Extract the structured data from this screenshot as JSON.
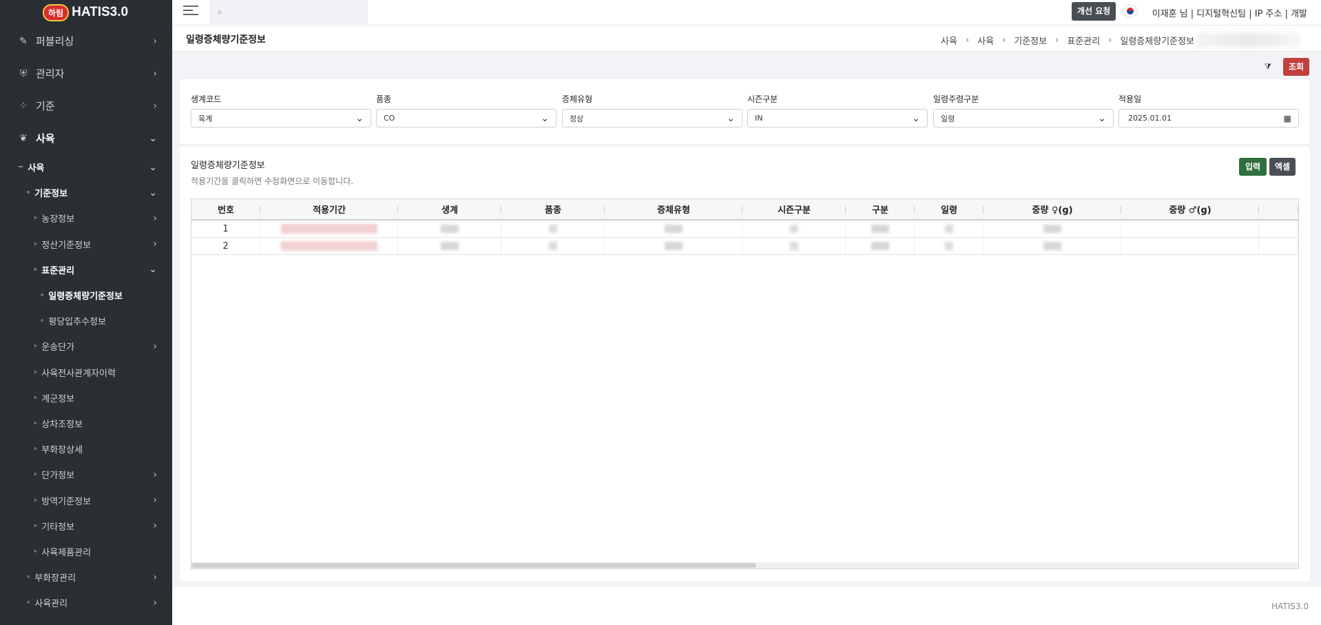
{
  "app": {
    "badge": "하림",
    "name": "HATIS3.0"
  },
  "sidebar": {
    "top": [
      {
        "icon": "rocket-icon",
        "glyph": "🚀",
        "label": "퍼블리싱"
      },
      {
        "icon": "shield-icon",
        "glyph": "⛨",
        "label": "관리자"
      },
      {
        "icon": "grid-icon",
        "glyph": "⁘",
        "label": "기준"
      },
      {
        "icon": "leaf-icon",
        "glyph": "❦",
        "label": "사육"
      }
    ],
    "items": [
      {
        "label": "사육"
      },
      {
        "label": "기준정보"
      },
      {
        "label": "농장정보"
      },
      {
        "label": "정산기준정보"
      },
      {
        "label": "표준관리"
      },
      {
        "label": "일령증체량기준정보"
      },
      {
        "label": "평당입추수정보"
      },
      {
        "label": "운송단가"
      },
      {
        "label": "사육전사관계자이력"
      },
      {
        "label": "계군정보"
      },
      {
        "label": "상차조정보"
      },
      {
        "label": "부화장상세"
      },
      {
        "label": "단가정보"
      },
      {
        "label": "방역기준정보"
      },
      {
        "label": "기타정보"
      },
      {
        "label": "사육제품관리"
      },
      {
        "label": "부화장관리"
      },
      {
        "label": "사육관리"
      }
    ]
  },
  "header": {
    "improve_btn": "개선 요청",
    "user_info": "이재훈 님 | 디지털혁신팀 | IP 주소 | 개발"
  },
  "page": {
    "title": "일령증체량기준정보",
    "breadcrumb": [
      "사육",
      "사육",
      "기준정보",
      "표준관리",
      "일령증체량기준정보"
    ]
  },
  "actions": {
    "search_btn": "조회"
  },
  "filters": [
    {
      "label": "생계코드",
      "value": "육계",
      "type": "select"
    },
    {
      "label": "품종",
      "value": "CO",
      "type": "select"
    },
    {
      "label": "증체유형",
      "value": "정상",
      "type": "select"
    },
    {
      "label": "시즌구분",
      "value": "IN",
      "type": "select"
    },
    {
      "label": "일령주령구분",
      "value": "일령",
      "type": "select"
    },
    {
      "label": "적용일",
      "value": "2025.01.01",
      "type": "date"
    }
  ],
  "table_panel": {
    "title": "일령증체량기준정보",
    "description": "적용기간을 클릭하면 수정화면으로 이동합니다.",
    "input_btn": "입력",
    "excel_btn": "엑셀"
  },
  "table": {
    "columns": [
      "번호",
      "적용기간",
      "생계",
      "품종",
      "증체유형",
      "시즌구분",
      "구분",
      "일령",
      "중량 ♀(g)",
      "중량 ♂(g)"
    ],
    "rows": [
      {
        "no": "1"
      },
      {
        "no": "2"
      }
    ]
  },
  "footer": {
    "version": "HATIS3.0"
  }
}
